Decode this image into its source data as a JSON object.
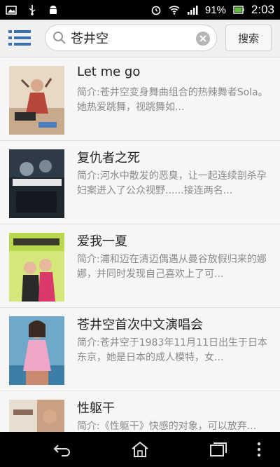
{
  "status_bar": {
    "battery_percent": "91%",
    "time": "2:03"
  },
  "search": {
    "query": "苍井空",
    "button_label": "搜索"
  },
  "results": [
    {
      "title": "Let me go",
      "description": "简介:苍井空变身舞曲组合的热辣舞者Sola。她热爱跳舞，视跳舞如..."
    },
    {
      "title": "复仇者之死",
      "description": "简介:河水中散发的恶臭，让一起连续剖杀孕妇案进入了公众视野......接连两名..."
    },
    {
      "title": "爱我一夏",
      "description": "简介:浦和迈在清迈偶遇从曼谷放假归来的娜娜，并同时发现自己喜欢上了可..."
    },
    {
      "title": "苍井空首次中文演唱会",
      "description": "简介:苍井空于1983年11月11日出生于日本东京，她是日本的成人模特，女..."
    },
    {
      "title": "性躯干",
      "description": "简介:《性躯干》快感的对象，可以放弃..."
    }
  ],
  "colors": {
    "accent": "#3a6fb0",
    "status_bar": "#000000",
    "toolbar": "#f0f0f0"
  }
}
